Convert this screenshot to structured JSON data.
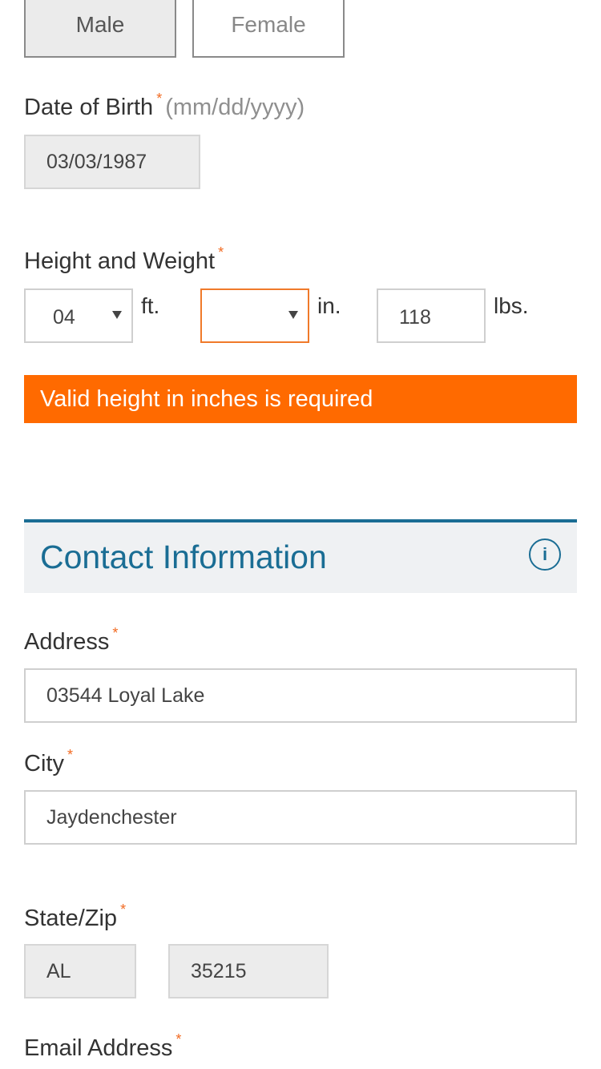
{
  "gender": {
    "male_label": "Male",
    "female_label": "Female",
    "selected": "Male"
  },
  "dob": {
    "label": "Date of Birth",
    "required_mark": "*",
    "hint": "(mm/dd/yyyy)",
    "value": "03/03/1987"
  },
  "height_weight": {
    "label": "Height and Weight",
    "required_mark": "*",
    "feet_value": "04",
    "feet_unit": "ft.",
    "inches_value": "",
    "inches_unit": "in.",
    "weight_value": "118",
    "weight_unit": "lbs.",
    "error": "Valid height in inches is required"
  },
  "contact": {
    "title": "Contact Information",
    "info_icon": "info-icon",
    "address": {
      "label": "Address",
      "required_mark": "*",
      "value": "03544 Loyal Lake"
    },
    "city": {
      "label": "City",
      "required_mark": "*",
      "value": "Jaydenchester"
    },
    "state_zip": {
      "label": "State/Zip",
      "required_mark": "*",
      "state_value": "AL",
      "zip_value": "35215"
    },
    "email": {
      "label": "Email Address",
      "required_mark": "*"
    }
  },
  "colors": {
    "accent": "#1a6d94",
    "error": "#ff6a00",
    "required": "#f26a21"
  }
}
